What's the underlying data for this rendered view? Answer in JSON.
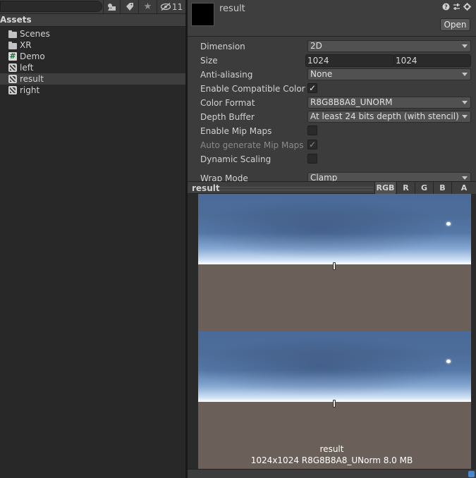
{
  "project": {
    "toolbar": {
      "search_value": "",
      "hidden_count": "11"
    },
    "header": "Assets",
    "items": [
      {
        "label": "Scenes",
        "icon": "folder-icon"
      },
      {
        "label": "XR",
        "icon": "folder-icon"
      },
      {
        "label": "Demo",
        "icon": "csharp-script-icon",
        "glyph": "#"
      },
      {
        "label": "left",
        "icon": "render-texture-icon"
      },
      {
        "label": "result",
        "icon": "render-texture-icon",
        "selected": true
      },
      {
        "label": "right",
        "icon": "render-texture-icon"
      }
    ]
  },
  "inspector": {
    "title": "result",
    "open_label": "Open",
    "properties": {
      "dimension": {
        "label": "Dimension",
        "value": "2D"
      },
      "size": {
        "label": "Size",
        "width": "1024",
        "sep": "x",
        "height": "1024"
      },
      "anti_aliasing": {
        "label": "Anti-aliasing",
        "value": "None"
      },
      "compatible_format": {
        "label": "Enable Compatible Color Format",
        "checked": "✓"
      },
      "color_format": {
        "label": "Color Format",
        "value": "R8G8B8A8_UNORM"
      },
      "depth_buffer": {
        "label": "Depth Buffer",
        "value": "At least 24 bits depth (with stencil)"
      },
      "mip_maps": {
        "label": "Enable Mip Maps",
        "checked": ""
      },
      "auto_mip": {
        "label": "Auto generate Mip Maps",
        "checked": "✓"
      },
      "dynamic_scaling": {
        "label": "Dynamic Scaling",
        "checked": ""
      },
      "wrap_mode": {
        "label": "Wrap Mode",
        "value": "Clamp"
      }
    },
    "preview": {
      "title": "result",
      "channels": [
        "RGB",
        "R",
        "G",
        "B",
        "A"
      ],
      "active_channel": "RGB",
      "name": "result",
      "info": "1024x1024  R8G8B8A8_UNorm  8.0 MB"
    }
  },
  "colors": {
    "panel_bg": "#282828",
    "inspector_bg": "#3c3c3c",
    "accent": "#4a88c9"
  }
}
